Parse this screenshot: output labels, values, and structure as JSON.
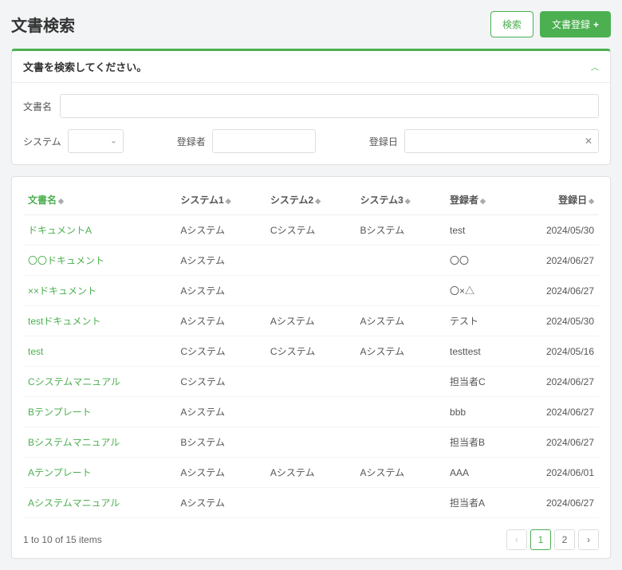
{
  "page_title": "文書検索",
  "header": {
    "search_btn": "検索",
    "register_btn": "文書登録"
  },
  "search_panel": {
    "title": "文書を検索してください。",
    "doc_name_label": "文書名",
    "system_label": "システム",
    "registrant_label": "登録者",
    "date_label": "登録日"
  },
  "table": {
    "headers": {
      "doc_name": "文書名",
      "system1": "システム1",
      "system2": "システム2",
      "system3": "システム3",
      "registrant": "登録者",
      "date": "登録日"
    },
    "rows": [
      {
        "doc_name": "ドキュメントA",
        "system1": "Aシステム",
        "system2": "Cシステム",
        "system3": "Bシステム",
        "registrant": "test",
        "date": "2024/05/30"
      },
      {
        "doc_name": "〇〇ドキュメント",
        "system1": "Aシステム",
        "system2": "",
        "system3": "",
        "registrant": "〇〇",
        "date": "2024/06/27"
      },
      {
        "doc_name": "××ドキュメント",
        "system1": "Aシステム",
        "system2": "",
        "system3": "",
        "registrant": "〇×△",
        "date": "2024/06/27"
      },
      {
        "doc_name": "testドキュメント",
        "system1": "Aシステム",
        "system2": "Aシステム",
        "system3": "Aシステム",
        "registrant": "テスト",
        "date": "2024/05/30"
      },
      {
        "doc_name": "test",
        "system1": "Cシステム",
        "system2": "Cシステム",
        "system3": "Aシステム",
        "registrant": "testtest",
        "date": "2024/05/16"
      },
      {
        "doc_name": "Cシステムマニュアル",
        "system1": "Cシステム",
        "system2": "",
        "system3": "",
        "registrant": "担当者C",
        "date": "2024/06/27"
      },
      {
        "doc_name": "Bテンプレート",
        "system1": "Aシステム",
        "system2": "",
        "system3": "",
        "registrant": "bbb",
        "date": "2024/06/27"
      },
      {
        "doc_name": "Bシステムマニュアル",
        "system1": "Bシステム",
        "system2": "",
        "system3": "",
        "registrant": "担当者B",
        "date": "2024/06/27"
      },
      {
        "doc_name": "Aテンプレート",
        "system1": "Aシステム",
        "system2": "Aシステム",
        "system3": "Aシステム",
        "registrant": "AAA",
        "date": "2024/06/01"
      },
      {
        "doc_name": "Aシステムマニュアル",
        "system1": "Aシステム",
        "system2": "",
        "system3": "",
        "registrant": "担当者A",
        "date": "2024/06/27"
      }
    ]
  },
  "pagination": {
    "summary": "1 to 10 of 15 items",
    "pages": [
      "1",
      "2"
    ]
  }
}
